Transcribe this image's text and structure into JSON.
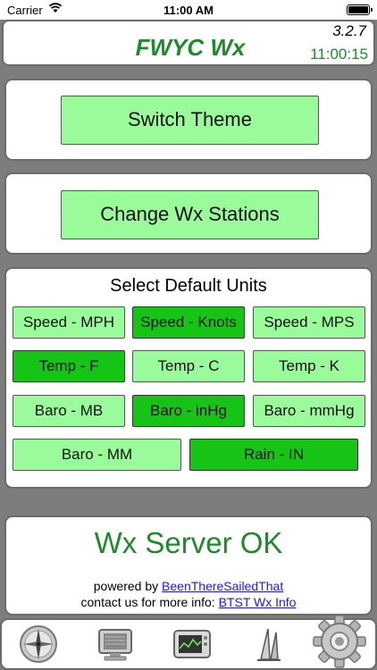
{
  "status_bar": {
    "carrier": "Carrier",
    "time": "11:00 AM"
  },
  "header": {
    "title": "FWYC Wx",
    "version": "3.2.7",
    "clock": "11:00:15"
  },
  "buttons": {
    "switch_theme": "Switch Theme",
    "change_stations": "Change Wx Stations"
  },
  "units": {
    "title": "Select Default Units",
    "options": [
      {
        "label": "Speed - MPH",
        "selected": false
      },
      {
        "label": "Speed - Knots",
        "selected": true
      },
      {
        "label": "Speed - MPS",
        "selected": false
      },
      {
        "label": "Temp - F",
        "selected": true
      },
      {
        "label": "Temp - C",
        "selected": false
      },
      {
        "label": "Temp - K",
        "selected": false
      },
      {
        "label": "Baro - MB",
        "selected": false
      },
      {
        "label": "Baro - inHg",
        "selected": true
      },
      {
        "label": "Baro - mmHg",
        "selected": false
      },
      {
        "label": "Baro - MM",
        "selected": false
      },
      {
        "label": "Rain - IN",
        "selected": true
      }
    ]
  },
  "server": {
    "status": "Wx Server OK"
  },
  "credits": {
    "powered_prefix": "powered by ",
    "powered_link": "BeenThereSailedThat",
    "contact_prefix": "contact us for more info: ",
    "contact_link": "BTST Wx Info"
  },
  "tabs": [
    {
      "icon": "compass-icon"
    },
    {
      "icon": "monitor-icon"
    },
    {
      "icon": "graph-icon"
    },
    {
      "icon": "sails-icon"
    },
    {
      "icon": "gear-icon"
    }
  ],
  "colors": {
    "accent_green": "#1e8a2c",
    "button_light": "#99fb99",
    "button_selected": "#16c416",
    "background": "#7d7d7d"
  }
}
